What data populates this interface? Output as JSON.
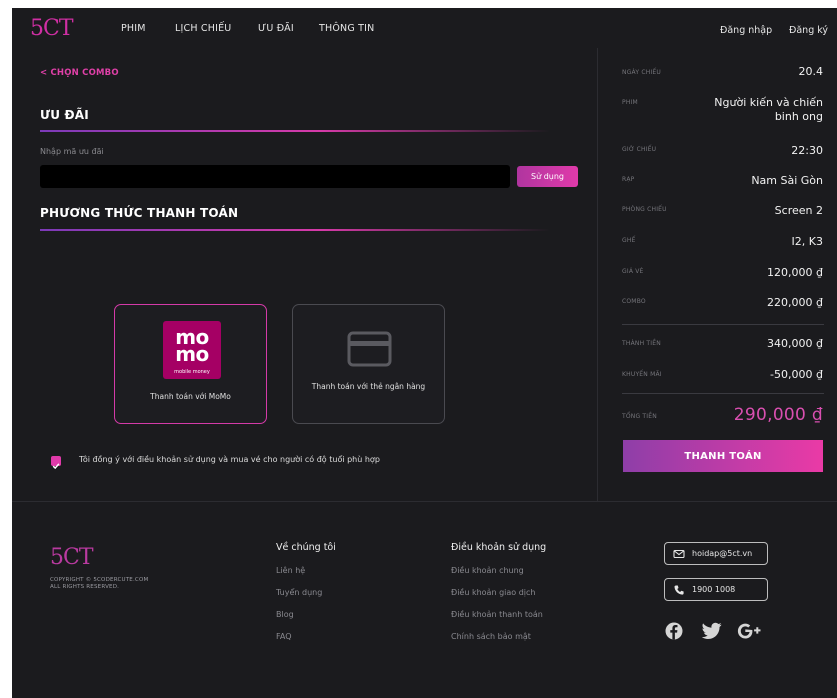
{
  "header": {
    "logo": "5CT",
    "nav": [
      "PHIM",
      "LỊCH CHIẾU",
      "ƯU ĐÃI",
      "THÔNG TIN"
    ],
    "login": "Đăng nhập",
    "register": "Đăng ký"
  },
  "main": {
    "back_label": "< CHỌN COMBO",
    "promo_title": "ƯU ĐÃI",
    "promo_label": "Nhập mã ưu đãi",
    "promo_value": "",
    "use_button": "Sử dụng",
    "payment_title": "PHƯƠNG THỨC THANH TOÁN",
    "momo_logo_top": "mo",
    "momo_logo_bottom": "mo",
    "momo_logo_sub": "mobile money",
    "momo_label": "Thanh toán với MoMo",
    "card_label": "Thanh toán với thẻ ngân hàng",
    "agree_text": "Tôi đồng ý với điều khoản sử dụng và mua vé cho người có độ tuổi phù hợp",
    "agree_checked": true
  },
  "summary": {
    "rows": [
      {
        "label": "NGÀY CHIẾU",
        "value": "20.4"
      },
      {
        "label": "PHIM",
        "value": "Người kiến và chiến binh ong"
      },
      {
        "label": "GIỜ CHIẾU",
        "value": "22:30"
      },
      {
        "label": "RẠP",
        "value": "Nam Sài Gòn"
      },
      {
        "label": "PHÒNG CHIẾU",
        "value": "Screen 2"
      },
      {
        "label": "GHẾ",
        "value": "I2, K3"
      },
      {
        "label": "GIÁ VÉ",
        "value": "120,000 ₫"
      },
      {
        "label": "COMBO",
        "value": "220,000 ₫"
      },
      {
        "label": "THÀNH TIỀN",
        "value": "340,000 ₫"
      },
      {
        "label": "KHUYẾN MÃI",
        "value": "-50,000 ₫"
      }
    ],
    "total_label": "TỔNG TIỀN",
    "total_value": "290,000 ₫",
    "pay_button": "THANH TOÁN"
  },
  "footer": {
    "logo": "5CT",
    "copyright_1": "COPYRIGHT © 5CODERCUTE.COM",
    "copyright_2": "ALL RIGHTS RESERVED.",
    "about_title": "Về chúng tôi",
    "about_links": [
      "Liên hệ",
      "Tuyển dụng",
      "Blog",
      "FAQ"
    ],
    "terms_title": "Điều khoản sử dụng",
    "terms_links": [
      "Điều khoản chung",
      "Điều khoản giao dịch",
      "Điều khoản thanh toán",
      "Chính sách bảo mật"
    ],
    "email": "hoidap@5ct.vn",
    "phone": "1900 1008",
    "social_icons": [
      "facebook-icon",
      "twitter-icon",
      "google-plus-icon"
    ]
  },
  "colors": {
    "accent": "#e03aaa",
    "background": "#1b1b1e",
    "total": "#d94fb0",
    "momo": "#a50064"
  }
}
